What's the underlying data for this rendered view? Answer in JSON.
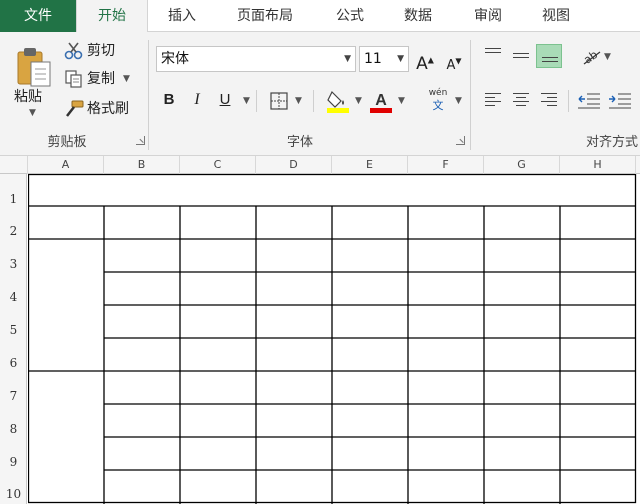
{
  "tabs": {
    "file": "文件",
    "home": "开始",
    "insert": "插入",
    "page_layout": "页面布局",
    "formulas": "公式",
    "data": "数据",
    "review": "审阅",
    "view": "视图"
  },
  "clipboard": {
    "paste": "粘贴",
    "cut": "剪切",
    "copy": "复制",
    "format_painter": "格式刷",
    "group_label": "剪贴板"
  },
  "font": {
    "name": "宋体",
    "size": "11",
    "bold": "B",
    "italic": "I",
    "underline": "U",
    "phonetic_top": "wén",
    "phonetic_bottom": "文",
    "group_label": "字体",
    "fill_color": "#ffff00",
    "font_color": "#e00000"
  },
  "alignment": {
    "group_label": "对齐方式"
  },
  "sheet": {
    "columns": [
      "A",
      "B",
      "C",
      "D",
      "E",
      "F",
      "G",
      "H"
    ],
    "rows": [
      "1",
      "2",
      "3",
      "4",
      "5",
      "6",
      "7",
      "8",
      "9",
      "10"
    ]
  },
  "colors": {
    "accent": "#217346",
    "selected_align": "#a9dbb7"
  }
}
